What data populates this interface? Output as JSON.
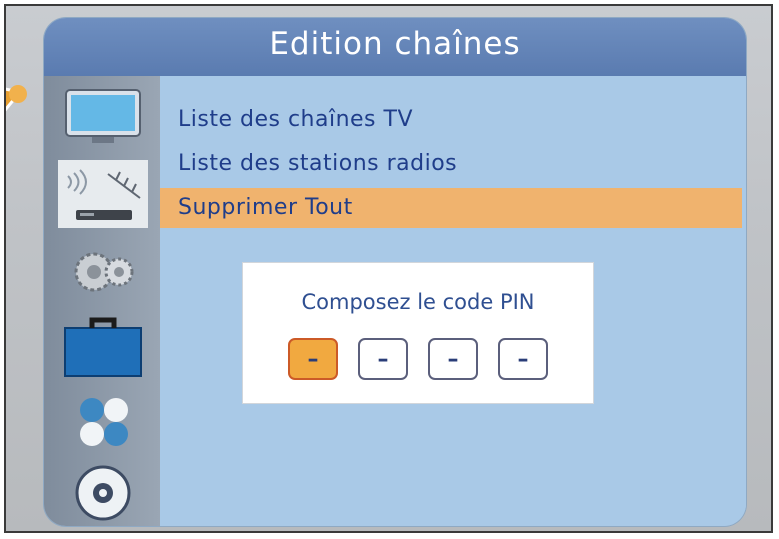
{
  "header": {
    "title": "Edition chaînes"
  },
  "sidebar": {
    "icons": [
      "tv-icon",
      "antenna-receiver-icon",
      "gears-icon",
      "toolbox-icon",
      "balls-icon",
      "disc-icon"
    ],
    "active_index": 0
  },
  "menu": {
    "items": [
      {
        "label": "Liste des chaînes TV"
      },
      {
        "label": "Liste des stations radios"
      },
      {
        "label": "Supprimer Tout"
      }
    ],
    "selected_index": 2
  },
  "pin_dialog": {
    "title": "Composez le code PIN",
    "digits": [
      "–",
      "–",
      "–",
      "–"
    ],
    "active_digit_index": 0
  },
  "colors": {
    "title_bar": "#5a7bb0",
    "panel": "#a9c9e7",
    "selection": "#f0b36e",
    "text": "#1f3d8a",
    "pin_active": "#f1a940"
  }
}
